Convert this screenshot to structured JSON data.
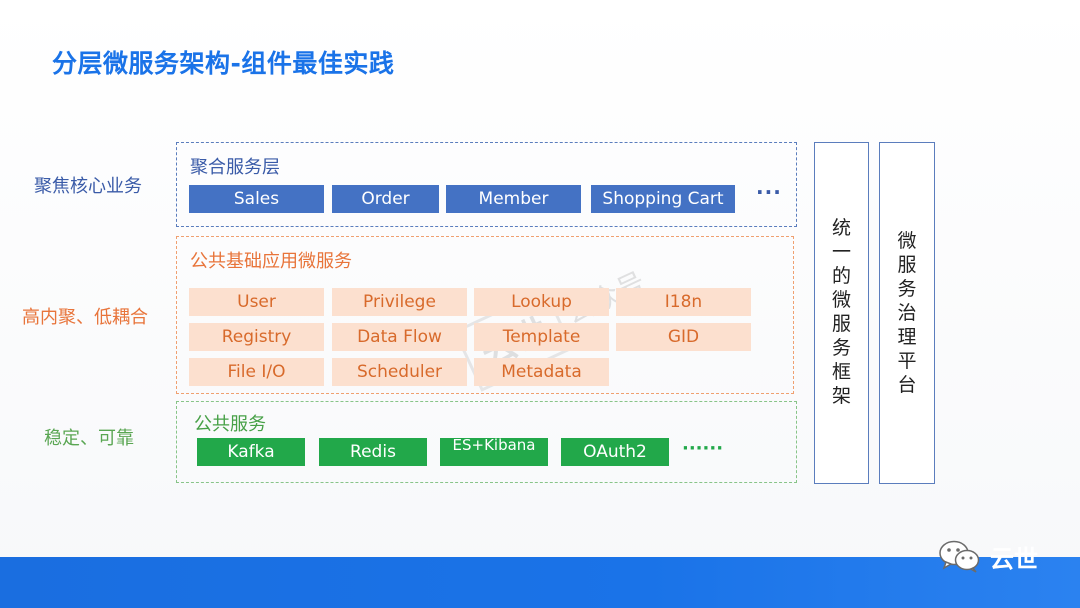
{
  "slide": {
    "title": "分层微服务架构-组件最佳实践"
  },
  "row_labels": [
    "聚焦核心业务",
    "高内聚、低耦合",
    "稳定、可靠"
  ],
  "layers": {
    "aggregate": {
      "title": "聚合服务层",
      "items": [
        "Sales",
        "Order",
        "Member",
        "Shopping Cart"
      ],
      "more": "···"
    },
    "basic": {
      "title": "公共基础应用微服务",
      "items": [
        "User",
        "Privilege",
        "Lookup",
        "I18n",
        "Registry",
        "Data Flow",
        "Template",
        "GID",
        "File I/O",
        "Scheduler",
        "Metadata"
      ]
    },
    "common": {
      "title": "公共服务",
      "items": [
        "Kafka",
        "Redis",
        "ES+Kibana",
        "OAuth2"
      ],
      "more": "······"
    }
  },
  "side_panels": [
    {
      "text": [
        "统",
        "一",
        "的",
        "微",
        "服",
        "务",
        "框",
        "架"
      ]
    },
    {
      "text": [
        "微",
        "服",
        "务",
        "治",
        "理",
        "平",
        "台"
      ]
    }
  ],
  "watermark": {
    "main": "云世",
    "sub": "公众号"
  },
  "footer": {
    "brand": "云世"
  },
  "colors": {
    "title": "#1a73e8",
    "aggregate_box": "#4472c4",
    "basic_box": "#fce0cf",
    "basic_text": "#d86a2b",
    "common_box": "#22a84a",
    "bottom_bar": "#1a73e8"
  }
}
